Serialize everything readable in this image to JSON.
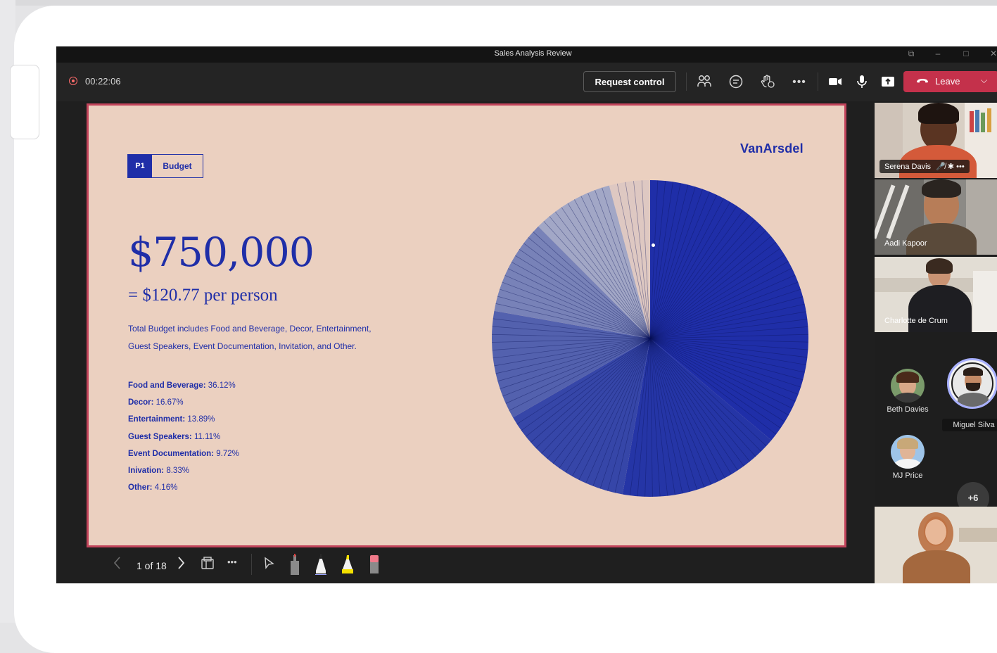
{
  "window": {
    "title": "Sales Analysis Review"
  },
  "toolbar": {
    "timer": "00:22:06",
    "request_control": "Request control",
    "leave_label": "Leave",
    "icons": [
      "people-icon",
      "chat-icon",
      "raise-hand-icon",
      "more-icon",
      "camera-icon",
      "mic-icon",
      "share-icon"
    ],
    "leave_color": "#c4314b"
  },
  "slide": {
    "badge_number": "P1",
    "badge_label": "Budget",
    "logo": "VanArsdel",
    "amount": "$750,000",
    "per_person": "= $120.77 per person",
    "description_line1": "Total Budget includes Food and Beverage, Decor, Entertainment,",
    "description_line2": "Guest Speakers, Event Documentation, Invitation, and Other.",
    "breakdown": [
      {
        "label": "Food and Beverage:",
        "value": "36.12%"
      },
      {
        "label": "Decor:",
        "value": "16.67%"
      },
      {
        "label": "Entertainment:",
        "value": "13.89%"
      },
      {
        "label": "Guest Speakers:",
        "value": "11.11%"
      },
      {
        "label": "Event Documentation:",
        "value": "9.72%"
      },
      {
        "label": "Inivation:",
        "value": "8.33%"
      },
      {
        "label": "Other:",
        "value": "4.16%"
      }
    ],
    "background_color": "#ebd0c0",
    "accent_color": "#1f2ea8"
  },
  "chart_data": {
    "type": "pie",
    "title": "",
    "categories": [
      "Food and Beverage",
      "Decor",
      "Entertainment",
      "Guest Speakers",
      "Event Documentation",
      "Inivation",
      "Other"
    ],
    "values": [
      36.12,
      16.67,
      13.89,
      11.11,
      9.72,
      8.33,
      4.16
    ],
    "colors": [
      "#1f2ea8",
      "#2535a6",
      "#3646a8",
      "#5361ae",
      "#7882b8",
      "#a2a7c6",
      "#dec8c2"
    ]
  },
  "presenter_controls": {
    "page_indicator": "1 of 18",
    "tools": [
      "prev-icon",
      "next-icon",
      "slides-grid-icon",
      "more-icon",
      "pointer-icon",
      "red-pen-icon",
      "black-pen-icon",
      "highlighter-icon",
      "eraser-icon"
    ]
  },
  "participants": {
    "video_tiles": [
      {
        "name": "Serena Davis",
        "status_icons": "🎤̸ ✱ •••"
      },
      {
        "name": "Aadi Kapoor"
      },
      {
        "name": "Charlotte de Crum"
      }
    ],
    "avatars": [
      {
        "name": "Beth Davies"
      },
      {
        "name": "Miguel Silva"
      },
      {
        "name": "MJ Price"
      }
    ],
    "overflow_count": "+6"
  }
}
